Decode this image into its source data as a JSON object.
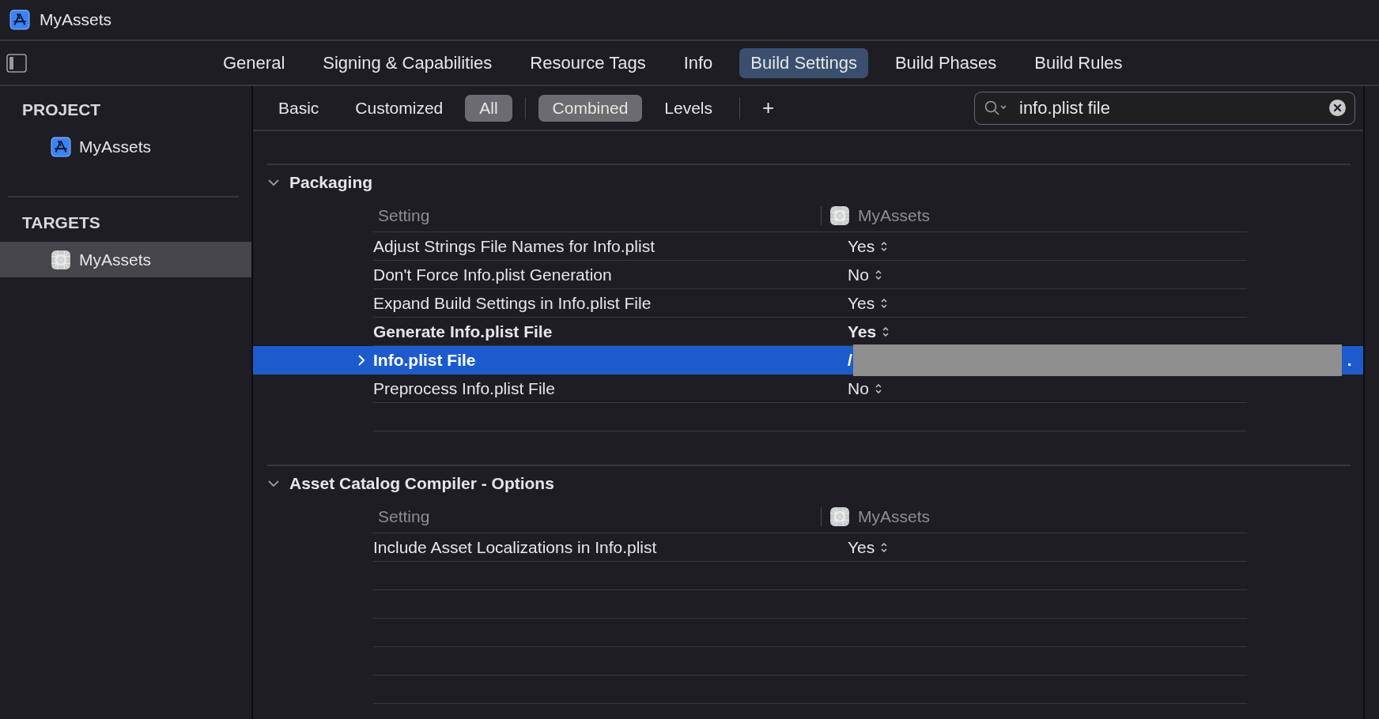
{
  "window": {
    "title": "MyAssets"
  },
  "tabs": [
    {
      "label": "General",
      "selected": false
    },
    {
      "label": "Signing & Capabilities",
      "selected": false
    },
    {
      "label": "Resource Tags",
      "selected": false
    },
    {
      "label": "Info",
      "selected": false
    },
    {
      "label": "Build Settings",
      "selected": true
    },
    {
      "label": "Build Phases",
      "selected": false
    },
    {
      "label": "Build Rules",
      "selected": false
    }
  ],
  "sidebar": {
    "sections": [
      {
        "title": "PROJECT",
        "items": [
          {
            "label": "MyAssets",
            "kind": "project",
            "selected": false
          }
        ]
      },
      {
        "title": "TARGETS",
        "items": [
          {
            "label": "MyAssets",
            "kind": "target",
            "selected": true
          }
        ]
      }
    ]
  },
  "filters": {
    "scope": [
      {
        "label": "Basic",
        "selected": false
      },
      {
        "label": "Customized",
        "selected": false
      },
      {
        "label": "All",
        "selected": true
      }
    ],
    "view": [
      {
        "label": "Combined",
        "selected": true
      },
      {
        "label": "Levels",
        "selected": false
      }
    ],
    "add": "+"
  },
  "search": {
    "value": "info.plist file"
  },
  "groups": [
    {
      "title": "Packaging",
      "expanded": true,
      "column_setting": "Setting",
      "column_target": "MyAssets",
      "rows": [
        {
          "name": "Adjust Strings File Names for Info.plist",
          "value": "Yes",
          "bold": false,
          "selected": false,
          "kind": "popup"
        },
        {
          "name": "Don't Force Info.plist Generation",
          "value": "No",
          "bold": false,
          "selected": false,
          "kind": "popup"
        },
        {
          "name": "Expand Build Settings in Info.plist File",
          "value": "Yes",
          "bold": false,
          "selected": false,
          "kind": "popup"
        },
        {
          "name": "Generate Info.plist File",
          "value": "Yes",
          "bold": true,
          "selected": false,
          "kind": "popup"
        },
        {
          "name": "Info.plist File",
          "value": "/",
          "value_end": ".",
          "bold": true,
          "selected": true,
          "kind": "path",
          "expanded": false,
          "redacted": true
        },
        {
          "name": "Preprocess Info.plist File",
          "value": "No",
          "bold": false,
          "selected": false,
          "kind": "popup"
        }
      ]
    },
    {
      "title": "Asset Catalog Compiler - Options",
      "expanded": true,
      "column_setting": "Setting",
      "column_target": "MyAssets",
      "rows": [
        {
          "name": "Include Asset Localizations in Info.plist",
          "value": "Yes",
          "bold": false,
          "selected": false,
          "kind": "popup"
        }
      ]
    }
  ]
}
